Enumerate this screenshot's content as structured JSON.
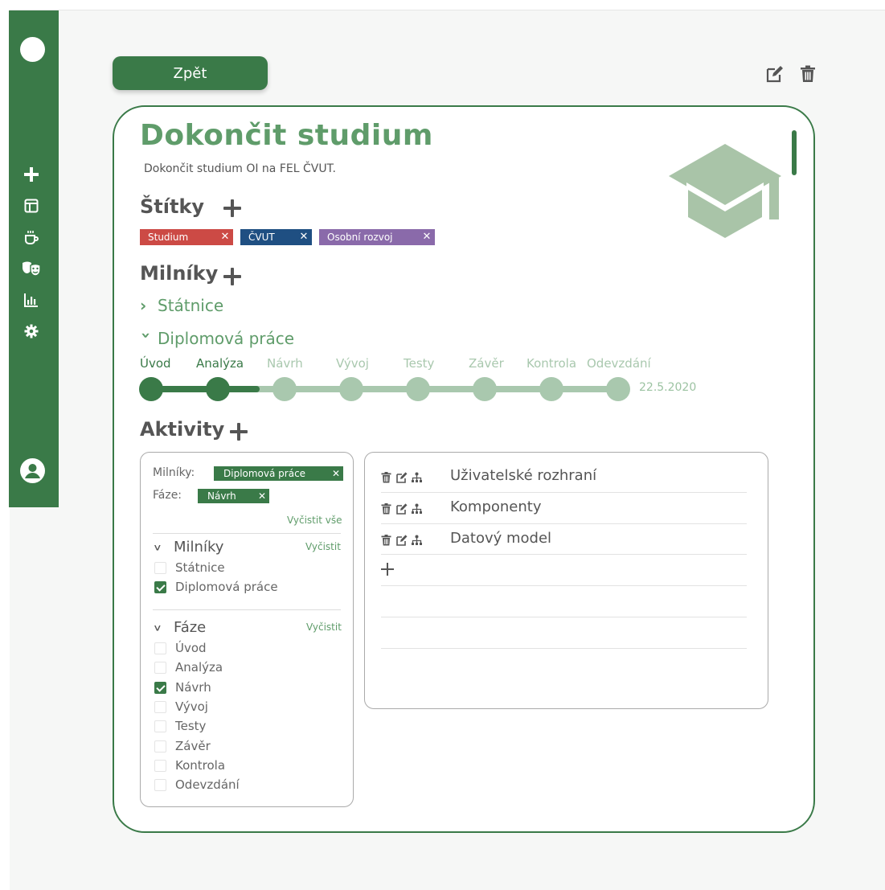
{
  "nav": {
    "icons": [
      "plus-icon",
      "layout-icon",
      "coffee-cup-icon",
      "theater-masks-icon",
      "bar-chart-icon",
      "gear-icon",
      "user-avatar-icon"
    ]
  },
  "header": {
    "back_label": "Zpět"
  },
  "goal": {
    "title": "Dokončit studium",
    "description": "Dokončit studium OI na FEL ČVUT.",
    "icon": "graduation-cap-icon"
  },
  "tags_section": {
    "heading": "Štítky",
    "tags": [
      {
        "label": "Studium",
        "color": "#cc4a45"
      },
      {
        "label": "ČVUT",
        "color": "#1f4f82"
      },
      {
        "label": "Osobní rozvoj",
        "color": "#8a6aaa"
      }
    ]
  },
  "milestones_section": {
    "heading": "Milníky",
    "milestones": [
      {
        "label": "Státnice",
        "expanded": false
      },
      {
        "label": "Diplomová práce",
        "expanded": true
      }
    ],
    "phases": [
      "Úvod",
      "Analýza",
      "Návrh",
      "Vývoj",
      "Testy",
      "Závěr",
      "Kontrola",
      "Odevzdání"
    ],
    "completed_phases": 2,
    "deadline": "22.5.2020"
  },
  "activities_section": {
    "heading": "Aktivity",
    "filter": {
      "milestones_label": "Milníky:",
      "phase_label": "Fáze:",
      "milestone_chip": "Diplomová práce",
      "phase_chip": "Návrh",
      "clear_all": "Vyčistit vše",
      "groups": [
        {
          "title": "Milníky",
          "clear": "Vyčistit",
          "options": [
            {
              "label": "Státnice",
              "checked": false
            },
            {
              "label": "Diplomová práce",
              "checked": true
            }
          ]
        },
        {
          "title": "Fáze",
          "clear": "Vyčistit",
          "options": [
            {
              "label": "Úvod",
              "checked": false
            },
            {
              "label": "Analýza",
              "checked": false
            },
            {
              "label": "Návrh",
              "checked": true
            },
            {
              "label": "Vývoj",
              "checked": false
            },
            {
              "label": "Testy",
              "checked": false
            },
            {
              "label": "Závěr",
              "checked": false
            },
            {
              "label": "Kontrola",
              "checked": false
            },
            {
              "label": "Odevzdání",
              "checked": false
            }
          ]
        }
      ]
    },
    "list": [
      {
        "name": "Uživatelské rozhraní"
      },
      {
        "name": "Komponenty"
      },
      {
        "name": "Datový model"
      }
    ]
  },
  "colors": {
    "primary": "#3a7a48",
    "accent_text": "#5f9c6a",
    "inactive_phase": "#a9c8ae"
  }
}
